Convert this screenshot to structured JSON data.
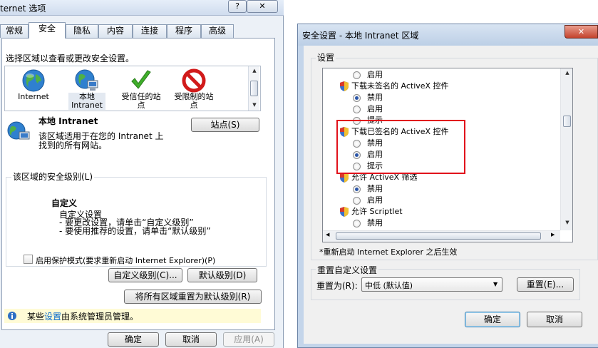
{
  "internet_options": {
    "title": "ternet 选项",
    "title_help": "?",
    "title_close": "✕",
    "tabs": [
      {
        "label": "常规"
      },
      {
        "label": "安全"
      },
      {
        "label": "隐私"
      },
      {
        "label": "内容"
      },
      {
        "label": "连接"
      },
      {
        "label": "程序"
      },
      {
        "label": "高级"
      }
    ],
    "zone_prompt": "选择区域以查看或更改安全设置。",
    "zones": [
      {
        "label": "Internet",
        "icon": "globe-icon"
      },
      {
        "label_line1": "本地",
        "label_line2": "Intranet",
        "icon": "intranet-globe-icon"
      },
      {
        "label_line1": "受信任的站",
        "label_line2": "点",
        "icon": "green-check-icon"
      },
      {
        "label_line1": "受限制的站",
        "label_line2": "点",
        "icon": "red-prohibited-icon"
      }
    ],
    "zone_info": {
      "name": "本地 Intranet",
      "description_line1": "该区域适用于在您的 Intranet 上",
      "description_line2": "找到的所有网站。",
      "sites_button": "站点(S)"
    },
    "security_level": {
      "legend": "该区域的安全级别(L)",
      "level_name": "自定义",
      "custom_settings": "自定义设置",
      "hint1": "- 要更改设置，请单击“自定义级别”",
      "hint2": "- 要使用推荐的设置，请单击“默认级别”",
      "protected_mode": "启用保护模式(要求重新启动 Internet Explorer)(P)",
      "custom_level_button": "自定义级别(C)...",
      "default_level_button": "默认级别(D)"
    },
    "reset_all_button": "将所有区域重置为默认级别(R)",
    "admin_notice_prefix": "某些",
    "admin_notice_link": "设置",
    "admin_notice_suffix": "由系统管理员管理。",
    "footer": {
      "ok": "确定",
      "cancel": "取消",
      "apply": "应用(A)"
    }
  },
  "security_settings": {
    "title": "安全设置 - 本地 Intranet 区域",
    "title_close": "✕",
    "settings_legend": "设置",
    "rows": [
      {
        "type": "radio",
        "label": "启用",
        "checked": false
      },
      {
        "type": "header",
        "label": "下载未签名的 ActiveX 控件"
      },
      {
        "type": "radio",
        "label": "禁用",
        "checked": true
      },
      {
        "type": "radio",
        "label": "启用",
        "checked": false
      },
      {
        "type": "radio",
        "label": "提示",
        "checked": false
      },
      {
        "type": "header",
        "label": "下载已签名的 ActiveX 控件"
      },
      {
        "type": "radio",
        "label": "禁用",
        "checked": false
      },
      {
        "type": "radio",
        "label": "启用",
        "checked": true
      },
      {
        "type": "radio",
        "label": "提示",
        "checked": false
      },
      {
        "type": "header",
        "label": "允许 ActiveX 筛选"
      },
      {
        "type": "radio",
        "label": "禁用",
        "checked": true
      },
      {
        "type": "radio",
        "label": "启用",
        "checked": false
      },
      {
        "type": "header",
        "label": "允许 Scriptlet"
      },
      {
        "type": "radio",
        "label": "禁用",
        "checked": false
      }
    ],
    "restart_note": "*重新启动 Internet Explorer 之后生效",
    "reset_legend": "重置自定义设置",
    "reset_to_label": "重置为(R):",
    "reset_level_value": "中低 (默认值)",
    "reset_button": "重置(E)...",
    "footer": {
      "ok": "确定",
      "cancel": "取消"
    }
  }
}
